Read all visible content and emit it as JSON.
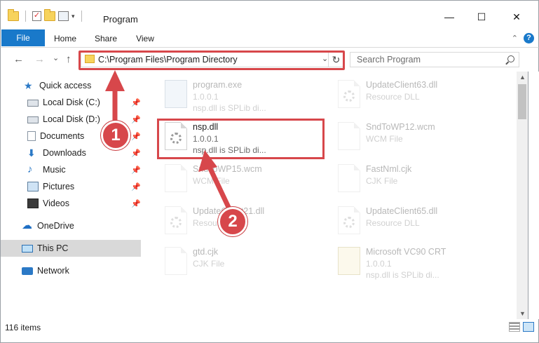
{
  "window": {
    "title": "Program",
    "minimize": "—",
    "maximize": "☐",
    "close": "✕"
  },
  "ribbon": {
    "tabs": [
      "File",
      "Home",
      "Share",
      "View"
    ],
    "help": "?"
  },
  "nav": {
    "back": "←",
    "forward": "→",
    "recent": "⌄",
    "up": "↑",
    "address": "C:\\Program Files\\Program Directory",
    "dropdown": "⌄",
    "refresh": "↻",
    "search_placeholder": "Search Program"
  },
  "sidebar": {
    "items": [
      {
        "label": "Quick access",
        "icon": "star-icon"
      },
      {
        "label": "Local Disk (C:)",
        "icon": "disk-icon",
        "pinned": true
      },
      {
        "label": "Local Disk (D:)",
        "icon": "disk-icon",
        "pinned": true
      },
      {
        "label": "Documents",
        "icon": "documents-icon",
        "pinned": true
      },
      {
        "label": "Downloads",
        "icon": "downloads-icon",
        "pinned": true
      },
      {
        "label": "Music",
        "icon": "music-icon",
        "pinned": true
      },
      {
        "label": "Pictures",
        "icon": "pictures-icon",
        "pinned": true
      },
      {
        "label": "Videos",
        "icon": "videos-icon",
        "pinned": true
      },
      {
        "label": "OneDrive",
        "icon": "onedrive-icon"
      },
      {
        "label": "This PC",
        "icon": "this-pc-icon",
        "selected": true
      },
      {
        "label": "Network",
        "icon": "network-icon"
      }
    ]
  },
  "files": [
    {
      "name": "program.exe",
      "line1": "1.0.0.1",
      "line2": "nsp.dll is SPLib di...",
      "faded": true
    },
    {
      "name": "UpdateClient63.dll",
      "line1": "Resource DLL",
      "line2": "",
      "faded": true
    },
    {
      "name": "nsp.dll",
      "line1": "1.0.0.1",
      "line2": "nsp.dll is SPLib di...",
      "faded": false
    },
    {
      "name": "SndToWP12.wcm",
      "line1": "WCM File",
      "line2": "",
      "faded": true
    },
    {
      "name": "SndToWP15.wcm",
      "line1": "WCM File",
      "line2": "",
      "faded": true
    },
    {
      "name": "FastNml.cjk",
      "line1": "CJK File",
      "line2": "",
      "faded": true
    },
    {
      "name": "UpdateClient21.dll",
      "line1": "Resource DLL",
      "line2": "",
      "faded": true
    },
    {
      "name": "UpdateClient65.dll",
      "line1": "Resource DLL",
      "line2": "",
      "faded": true
    },
    {
      "name": "gtd.cjk",
      "line1": "CJK File",
      "line2": "",
      "faded": true
    },
    {
      "name": "Microsoft VC90 CRT",
      "line1": "1.0.0.1",
      "line2": "nsp.dll is SPLib di...",
      "faded": true
    }
  ],
  "status": {
    "count": "116 items"
  },
  "annotations": {
    "step1": "1",
    "step2": "2",
    "color": "#d7474b"
  }
}
